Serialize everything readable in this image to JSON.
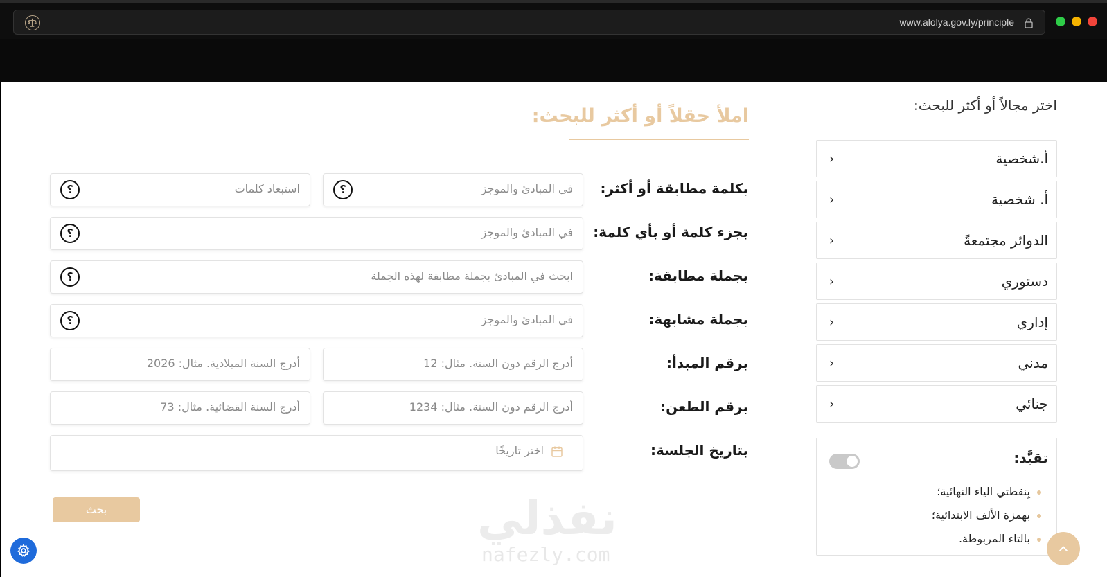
{
  "browser": {
    "url": "www.alolya.gov.ly/principle"
  },
  "sidebar": {
    "title": "اختر مجالاً أو أكثر للبحث:",
    "items": [
      {
        "label": "أ.شخصية"
      },
      {
        "label": "أ. شخصية"
      },
      {
        "label": "الدوائر مجتمعةً"
      },
      {
        "label": "دستوري"
      },
      {
        "label": "إداري"
      },
      {
        "label": "مدني"
      },
      {
        "label": "جنائي"
      }
    ],
    "restriction": {
      "title": "تقيَّد:",
      "items": [
        "بِنقطتي الياء النهائية؛",
        "بهمزة الألف الابتدائية؛",
        "بالتاء المربوطة."
      ]
    }
  },
  "form": {
    "title": "املأ حقلاً أو أكثر للبحث:",
    "rows": {
      "exact_word": {
        "label": "بكلمة مطابقة أو أكثر:",
        "placeholder": "في المبادئ والموجز",
        "exclude_placeholder": "استبعاد كلمات"
      },
      "partial_word": {
        "label": "بجزء كلمة أو بأي كلمة:",
        "placeholder": "في المبادئ والموجز"
      },
      "exact_phrase": {
        "label": "بجملة مطابقة:",
        "placeholder": "ابحث في المبادئ بجملة مطابقة لهذه الجملة"
      },
      "similar_phrase": {
        "label": "بجملة مشابهة:",
        "placeholder": "في المبادئ والموجز"
      },
      "principle_number": {
        "label": "برقم المبدأ:",
        "number_placeholder": "أدرج الرقم دون السنة. مثال: 12",
        "year_placeholder": "أدرج السنة الميلادية. مثال: 2026"
      },
      "appeal_number": {
        "label": "برقم الطعن:",
        "number_placeholder": "أدرج الرقم دون السنة. مثال: 1234",
        "year_placeholder": "أدرج السنة القضائية. مثال: 73"
      },
      "session_date": {
        "label": "بتاريخ الجلسة:",
        "placeholder": "اختر تاريخًا"
      }
    },
    "help_symbol": "؟",
    "search_button": "بحث"
  },
  "watermark": {
    "arabic": "نفذلي",
    "latin": "nafezly.com"
  },
  "colors": {
    "accent": "#e8c9a0",
    "settings_button": "#1f6bdb"
  },
  "icons": [
    "site-logo-icon",
    "lock-icon",
    "chevron-left-icon",
    "help-icon",
    "calendar-icon",
    "gear-icon",
    "arrow-up-icon"
  ]
}
